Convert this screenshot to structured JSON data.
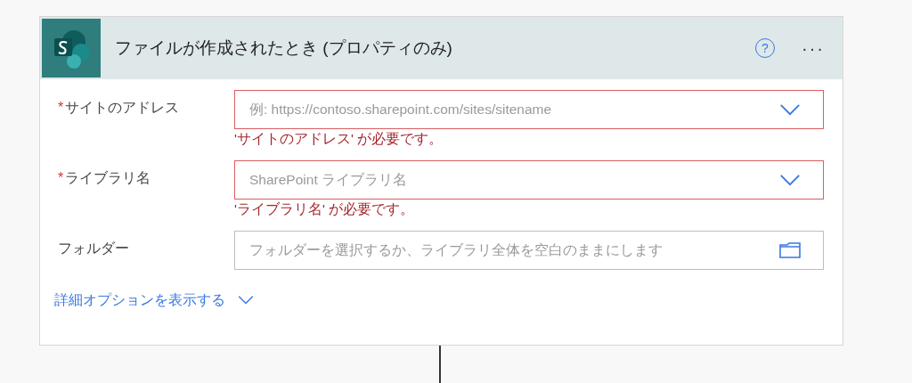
{
  "card": {
    "title": "ファイルが作成されたとき (プロパティのみ)",
    "help_icon": "?",
    "more_icon": "···"
  },
  "fields": [
    {
      "label": "サイトのアドレス",
      "required_mark": "*",
      "kind": "dropdown",
      "placeholder": "例: https://contoso.sharepoint.com/sites/sitename",
      "invalid": true,
      "error": "'サイトのアドレス' が必要です。"
    },
    {
      "label": "ライブラリ名",
      "required_mark": "*",
      "kind": "dropdown",
      "placeholder": "SharePoint ライブラリ名",
      "invalid": true,
      "error": "'ライブラリ名' が必要です。"
    },
    {
      "label": "フォルダー",
      "kind": "folder",
      "placeholder": "フォルダーを選択するか、ライブラリ全体を空白のままにします",
      "invalid": false
    }
  ],
  "advanced_link": {
    "label": "詳細オプションを表示する",
    "expanded": false
  }
}
